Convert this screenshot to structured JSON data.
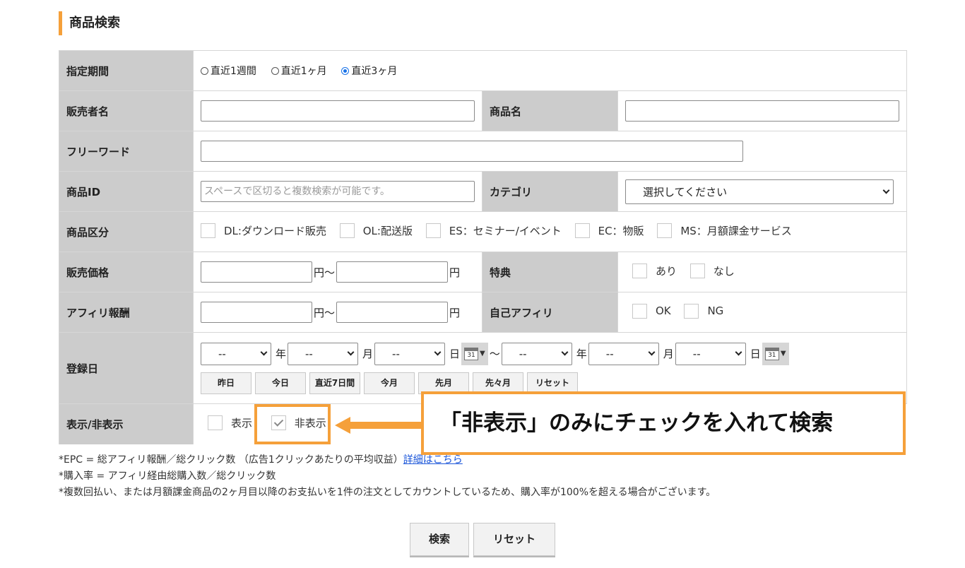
{
  "page": {
    "title": "商品検索"
  },
  "fields": {
    "period": {
      "label": "指定期間",
      "options": [
        "直近1週間",
        "直近1ヶ月",
        "直近3ヶ月"
      ],
      "selected": 2
    },
    "seller": {
      "label": "販売者名",
      "value": ""
    },
    "product_name": {
      "label": "商品名",
      "value": ""
    },
    "freeword": {
      "label": "フリーワード",
      "value": ""
    },
    "product_id": {
      "label": "商品ID",
      "placeholder": "スペースで区切ると複数検索が可能です。"
    },
    "category": {
      "label": "カテゴリ",
      "selected": "選択してください"
    },
    "product_type": {
      "label": "商品区分",
      "options": [
        "DL:ダウンロード販売",
        "OL:配送版",
        "ES：セミナー/イベント",
        "EC：物販",
        "MS：月額課金サービス"
      ]
    },
    "price": {
      "label": "販売価格",
      "unit_from": "円〜",
      "unit_to": "円"
    },
    "bonus": {
      "label": "特典",
      "options": [
        "あり",
        "なし"
      ]
    },
    "affiliate_reward": {
      "label": "アフィリ報酬",
      "unit_from": "円〜",
      "unit_to": "円"
    },
    "self_affiliate": {
      "label": "自己アフィリ",
      "options": [
        "OK",
        "NG"
      ]
    },
    "registered": {
      "label": "登録日",
      "select_value": "--",
      "units": [
        "年",
        "月",
        "日"
      ],
      "range_sep": "〜",
      "calendar_day": "31",
      "quick_buttons": [
        "昨日",
        "今日",
        "直近7日間",
        "今月",
        "先月",
        "先々月",
        "リセット"
      ]
    },
    "display": {
      "label": "表示/非表示",
      "options": [
        "表示",
        "非表示"
      ],
      "checked": [
        false,
        true
      ]
    }
  },
  "notes": [
    "*EPC = 総アフィリ報酬／総クリック数 （広告1クリックあたりの平均収益）",
    "*購入率 = アフィリ経由総購入数／総クリック数",
    "*複数回払い、または月額課金商品の2ヶ月目以降のお支払いを1件の注文としてカウントしているため、購入率が100%を超える場合がございます。"
  ],
  "notes_link": "詳細はこちら",
  "buttons": {
    "search": "検索",
    "reset": "リセット"
  },
  "callout": {
    "text": "「非表示」のみにチェックを入れて検索"
  },
  "colors": {
    "accent": "#f5a03a",
    "label_bg": "#cccccc",
    "link": "#1a55d9"
  }
}
